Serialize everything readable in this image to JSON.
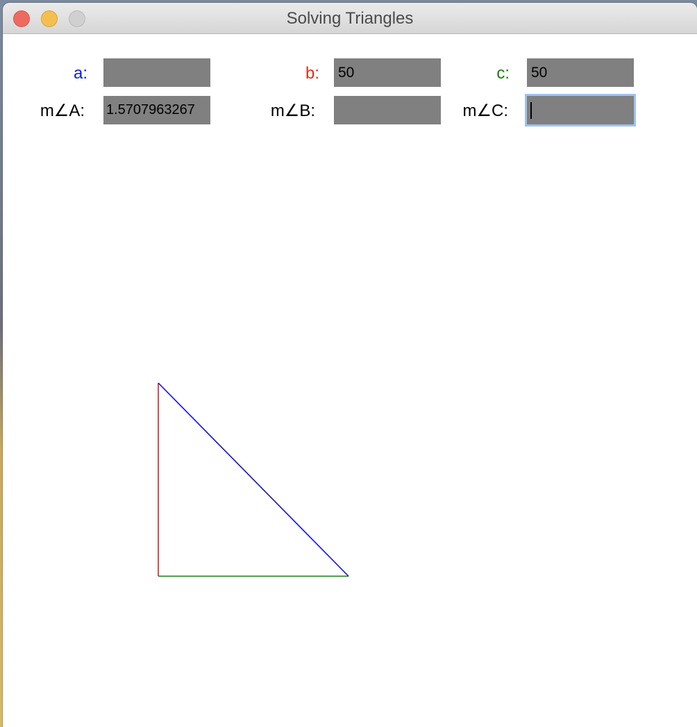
{
  "window": {
    "title": "Solving Triangles"
  },
  "sides": {
    "a": {
      "label": "a:",
      "value": "",
      "color": "#0a1ee0"
    },
    "b": {
      "label": "b:",
      "value": "50",
      "color": "#e0301e"
    },
    "c": {
      "label": "c:",
      "value": "50",
      "color": "#1f7a12"
    }
  },
  "angles": {
    "A": {
      "label": "m∠A:",
      "value": "1.5707963267"
    },
    "B": {
      "label": "m∠B:",
      "value": ""
    },
    "C": {
      "label": "m∠C:",
      "value": ""
    }
  },
  "focused_field": "angle-C",
  "triangle": {
    "side_a_color": "#1010e0",
    "side_b_color": "#d42020",
    "side_c_color": "#1f7a12"
  }
}
